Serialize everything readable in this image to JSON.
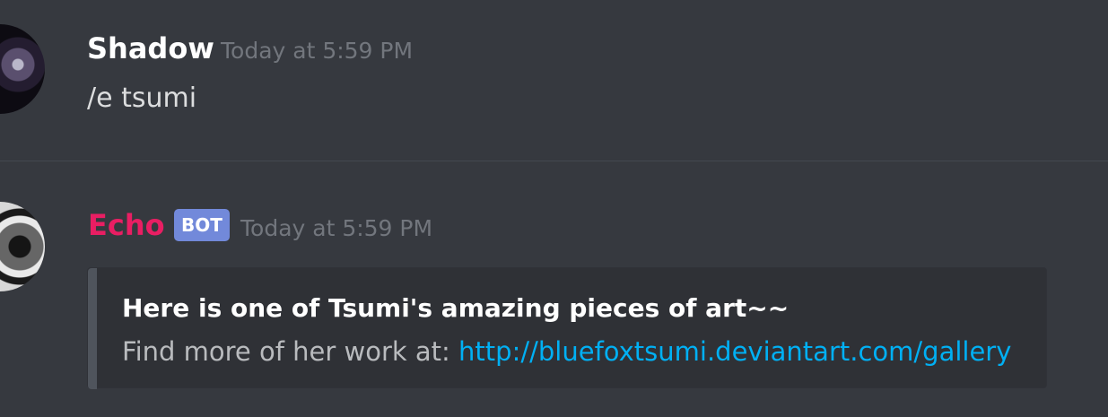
{
  "messages": [
    {
      "author": "Shadow",
      "timestamp": "Today at 5:59 PM",
      "content": "/e tsumi"
    },
    {
      "author": "Echo",
      "badge": "BOT",
      "timestamp": "Today at 5:59 PM",
      "embed": {
        "title": "Here is one of Tsumi's amazing pieces of art~~",
        "description_prefix": "Find more of her work at:",
        "link": "http://bluefoxtsumi.deviantart.com/gallery"
      }
    }
  ],
  "colors": {
    "background": "#36393f",
    "echo_name": "#e91e63",
    "bot_badge": "#7289da",
    "link": "#00b0f4"
  }
}
